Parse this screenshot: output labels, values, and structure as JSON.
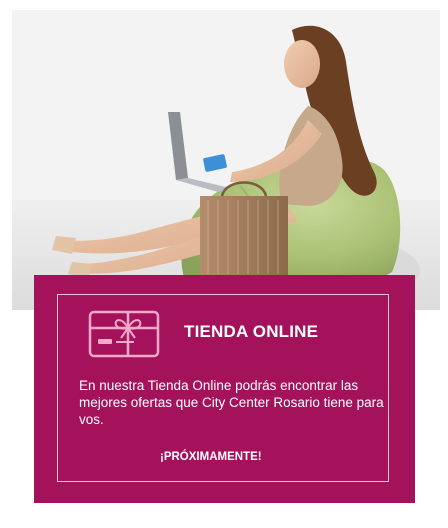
{
  "promo": {
    "title": "TIENDA ONLINE",
    "description": "En nuestra Tienda Online podrás encontrar las mejores ofertas que City Center Rosario tiene para vos.",
    "cta": "¡PRÓXIMAMENTE!",
    "icon": "gift-card-icon"
  },
  "colors": {
    "card_background": "#a5125c",
    "text": "#ffffff",
    "icon_fill": "#f4a9c8"
  },
  "photo": {
    "subject": "woman-shopping-online-image"
  }
}
